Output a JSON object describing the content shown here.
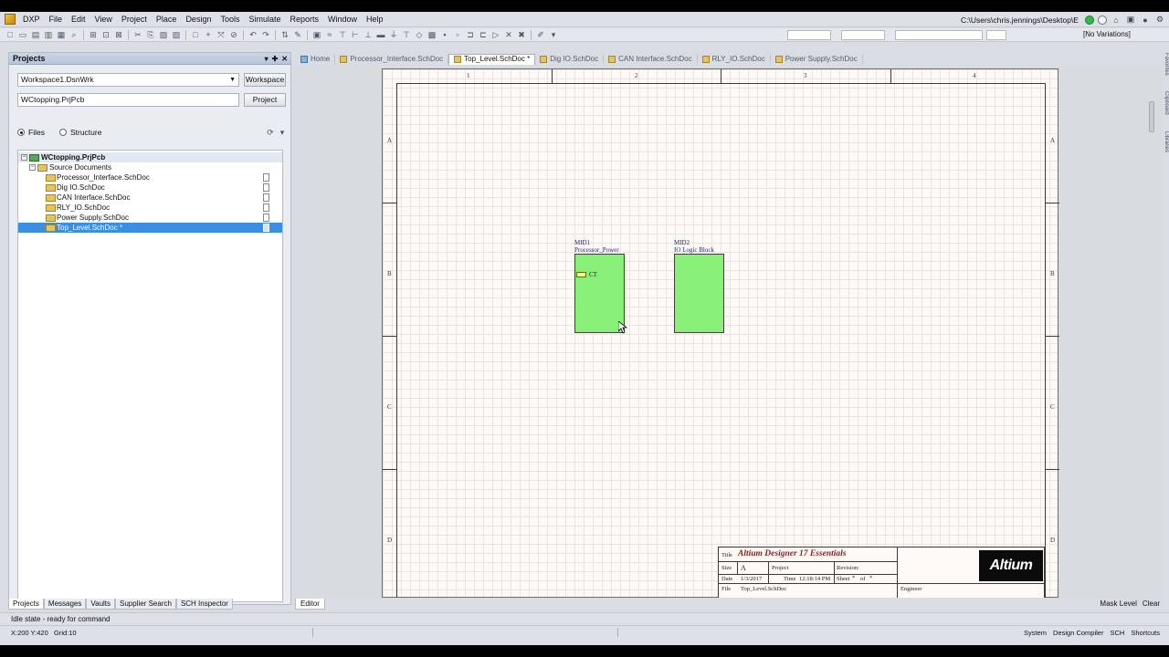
{
  "menu": {
    "items": [
      "DXP",
      "File",
      "Edit",
      "View",
      "Project",
      "Place",
      "Design",
      "Tools",
      "Simulate",
      "Reports",
      "Window",
      "Help"
    ],
    "path": "C:\\Users\\chris.jennings\\Desktop\\E"
  },
  "toolbar": {
    "variations": "[No Variations]"
  },
  "projects_panel": {
    "title": "Projects",
    "workspace_value": "Workspace1.DsnWrk",
    "workspace_button": "Workspace",
    "project_value": "WCtopping.PrjPcb",
    "project_button": "Project",
    "view_files": "Files",
    "view_structure": "Structure",
    "tree": {
      "project": "WCtopping.PrjPcb",
      "folder": "Source Documents",
      "documents": [
        "Processor_Interface.SchDoc",
        "Dig IO.SchDoc",
        "CAN Interface.SchDoc",
        "RLY_IO.SchDoc",
        "Power Supply.SchDoc",
        "Top_Level.SchDoc *"
      ]
    },
    "bottom_tabs": [
      "Projects",
      "Messages",
      "Vaults",
      "Supplier Search",
      "SCH Inspector"
    ]
  },
  "doc_tabs": [
    "Home",
    "Processor_Interface.SchDoc",
    "Top_Level.SchDoc *",
    "Dig IO.SchDoc",
    "CAN Interface.SchDoc",
    "RLY_IO.SchDoc",
    "Power Supply.SchDoc"
  ],
  "side_tabs": [
    "Favorites",
    "Clipboard",
    "Libraries"
  ],
  "schematic": {
    "zone_columns": [
      "1",
      "2",
      "3",
      "4"
    ],
    "zone_rows": [
      "A",
      "B",
      "C",
      "D"
    ],
    "symbols": [
      {
        "designator": "MID1",
        "filename": "Processor_Power",
        "entry": "CT"
      },
      {
        "designator": "MID2",
        "filename": "IO Logic Block"
      }
    ],
    "title_block": {
      "title_label": "Title",
      "title": "Altium Designer 17 Essentials",
      "size_label": "Size",
      "size": "A",
      "project_label": "Project",
      "revision_label": "Revision:",
      "date_label": "Date",
      "date": "1/3/2017",
      "time_label": "Time",
      "time": "12:18:14 PM",
      "sheet_label": "Sheet",
      "sheet": "*",
      "of_label": "of",
      "of": "*",
      "file_label": "File",
      "file": "Top_Level.SchDoc",
      "engineer_label": "Engineer",
      "logo": "Altium"
    }
  },
  "editor_tab": "Editor",
  "right_status": [
    "Mask Level",
    "Clear"
  ],
  "status": {
    "message": "Idle state - ready for command",
    "coords": "X:200 Y:420",
    "grid": "Grid:10",
    "buttons": [
      "System",
      "Design Compiler",
      "SCH",
      "Shortcuts"
    ]
  }
}
